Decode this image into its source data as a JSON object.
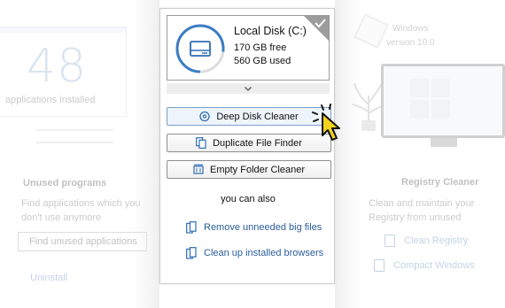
{
  "background": {
    "left": {
      "count": "48",
      "count_caption": "applications installed",
      "heading": "Unused programs",
      "description_line1": "Find applications which you",
      "description_line2": "don't use anymore",
      "button_label": "Find unused applications",
      "link_label": "Uninstall"
    },
    "right": {
      "os_line1": "Windows",
      "os_line2": "version 10.0",
      "heading": "Registry Cleaner",
      "description_line1": "Clean and maintain your",
      "description_line2": "Registry from unused",
      "link_clean": "Clean Registry",
      "link_compact": "Compact Windows"
    }
  },
  "disk": {
    "name": "Local Disk (C:)",
    "free": "170 GB free",
    "used": "560 GB used",
    "used_fraction": 0.77,
    "accent_color": "#3b7dc4",
    "icon": "hard-drive-icon"
  },
  "actions": {
    "deep_disk_cleaner": "Deep Disk Cleaner",
    "duplicate_file_finder": "Duplicate File Finder",
    "empty_folder_cleaner": "Empty Folder Cleaner"
  },
  "also_label": "you can also",
  "extra_links": {
    "remove_big_files": "Remove unneeded big files",
    "clean_browsers": "Clean up installed browsers"
  },
  "colors": {
    "link": "#2b5d9b",
    "cursor_fill": "#f4d21f"
  }
}
